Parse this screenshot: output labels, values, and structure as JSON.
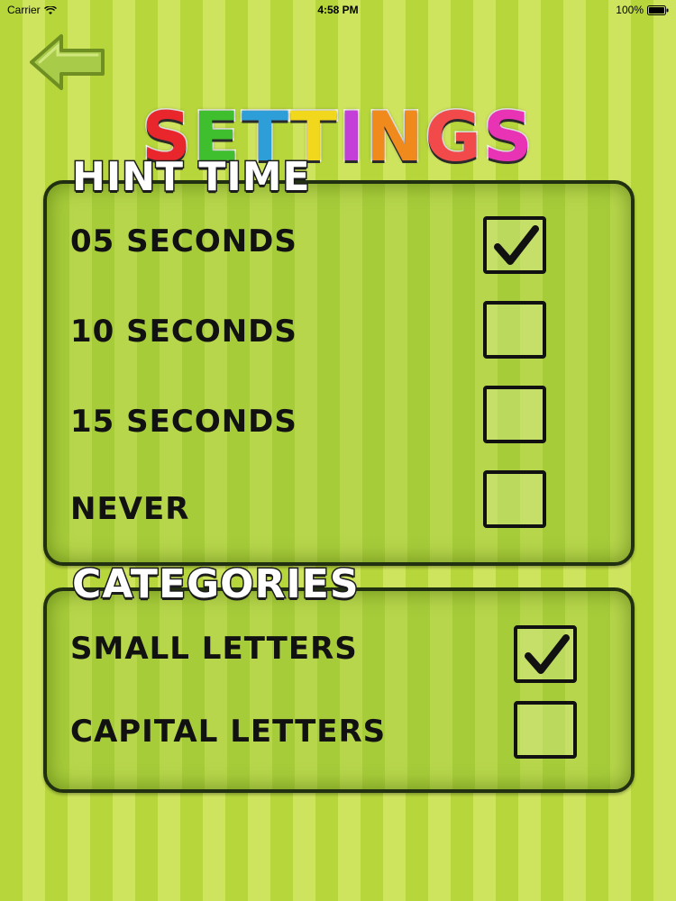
{
  "status_bar": {
    "carrier": "Carrier",
    "time": "4:58 PM",
    "battery": "100%"
  },
  "title": {
    "letters": [
      {
        "char": "S",
        "color": "#e8262c"
      },
      {
        "char": "E",
        "color": "#3fbf2e"
      },
      {
        "char": "T",
        "color": "#2e9ed8"
      },
      {
        "char": "T",
        "color": "#f2d81c"
      },
      {
        "char": "I",
        "color": "#c43fd8"
      },
      {
        "char": "N",
        "color": "#f08a1c"
      },
      {
        "char": "G",
        "color": "#f24a4a"
      },
      {
        "char": "S",
        "color": "#e833b4"
      }
    ]
  },
  "hint_time": {
    "heading": "HINT TIME",
    "options": [
      {
        "label": "05 SECONDS",
        "checked": true
      },
      {
        "label": "10 SECONDS",
        "checked": false
      },
      {
        "label": "15 SECONDS",
        "checked": false
      },
      {
        "label": "NEVER",
        "checked": false
      }
    ]
  },
  "categories": {
    "heading": "CATEGORIES",
    "options": [
      {
        "label": "SMALL LETTERS",
        "checked": true
      },
      {
        "label": "CAPITAL LETTERS",
        "checked": false
      }
    ]
  },
  "colors": {
    "stripe_dark": "#b6d63c",
    "stripe_light": "#cfe45e",
    "panel_border": "#203010",
    "back_arrow": "#a8cc4a"
  },
  "icons": {
    "back": "arrow-left-icon",
    "check": "checkmark-icon",
    "wifi": "wifi-icon",
    "battery": "battery-icon"
  }
}
